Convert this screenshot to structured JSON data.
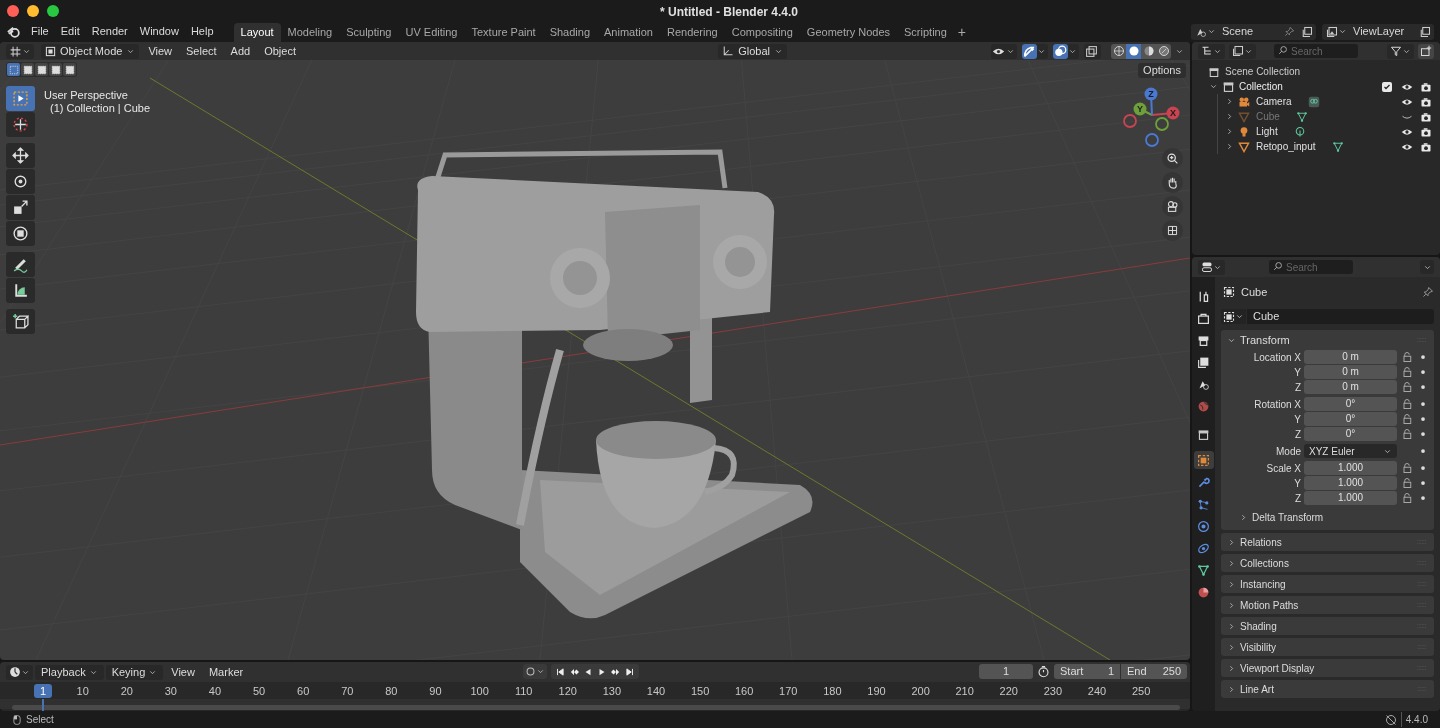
{
  "window": {
    "title": "* Untitled - Blender 4.4.0"
  },
  "menu": [
    "File",
    "Edit",
    "Render",
    "Window",
    "Help"
  ],
  "workspaces": [
    {
      "label": "Layout",
      "selected": true
    },
    {
      "label": "Modeling",
      "selected": false
    },
    {
      "label": "Sculpting",
      "selected": false
    },
    {
      "label": "UV Editing",
      "selected": false
    },
    {
      "label": "Texture Paint",
      "selected": false
    },
    {
      "label": "Shading",
      "selected": false
    },
    {
      "label": "Animation",
      "selected": false
    },
    {
      "label": "Rendering",
      "selected": false
    },
    {
      "label": "Compositing",
      "selected": false
    },
    {
      "label": "Geometry Nodes",
      "selected": false
    },
    {
      "label": "Scripting",
      "selected": false
    }
  ],
  "add_workspace": "+",
  "scene": {
    "scene": "Scene",
    "view_layer": "ViewLayer"
  },
  "viewport": {
    "mode": "Object Mode",
    "menus": [
      "View",
      "Select",
      "Add",
      "Object"
    ],
    "orientation": "Global",
    "options": "Options",
    "info": [
      "User Perspective",
      "(1) Collection | Cube"
    ],
    "select_modes": [
      {
        "selected": true
      },
      {
        "selected": false
      },
      {
        "selected": false
      },
      {
        "selected": false
      },
      {
        "selected": false
      }
    ],
    "toggles": [
      {
        "kind": "visibility",
        "on": false
      },
      {
        "kind": "gizmo",
        "on": true
      },
      {
        "kind": "overlay",
        "on": true
      },
      {
        "kind": "xray",
        "on": false
      }
    ],
    "shading": [
      {
        "kind": "wireframe",
        "selected": false
      },
      {
        "kind": "solid",
        "selected": true
      },
      {
        "kind": "material",
        "selected": false
      },
      {
        "kind": "rendered",
        "selected": false
      }
    ],
    "axes": [
      "X",
      "Y",
      "Z"
    ],
    "tools": [
      [
        {
          "kind": "select",
          "selected": true
        },
        {
          "kind": "cursor",
          "selected": false
        }
      ],
      [
        {
          "kind": "move",
          "selected": false
        },
        {
          "kind": "rotate",
          "selected": false
        },
        {
          "kind": "scale",
          "selected": false
        },
        {
          "kind": "transform",
          "selected": false
        }
      ],
      [
        {
          "kind": "annotate",
          "selected": false
        },
        {
          "kind": "measure",
          "selected": false
        }
      ],
      [
        {
          "kind": "add_cube",
          "selected": false
        }
      ]
    ]
  },
  "outliner": {
    "search_placeholder": "Search",
    "root": "Scene Collection",
    "collection": {
      "label": "Collection",
      "expanded": true,
      "checked": true,
      "children": [
        {
          "label": "Camera",
          "kind": "camera",
          "hidden": false
        },
        {
          "label": "Cube",
          "kind": "mesh",
          "hidden": true
        },
        {
          "label": "Light",
          "kind": "light",
          "hidden": false
        },
        {
          "label": "Retopo_input",
          "kind": "mesh",
          "hidden": false
        }
      ]
    }
  },
  "properties": {
    "search_placeholder": "Search",
    "object": "Cube",
    "name": "Cube",
    "tabs": [
      {
        "kind": "tool",
        "selected": false
      },
      {
        "kind": "render",
        "selected": false
      },
      {
        "kind": "output",
        "selected": false
      },
      {
        "kind": "view_layer",
        "selected": false
      },
      {
        "kind": "scene",
        "selected": false
      },
      {
        "kind": "world",
        "selected": false
      },
      {
        "kind": "collection",
        "selected": false
      },
      {
        "kind": "object",
        "selected": true
      },
      {
        "kind": "modifiers",
        "selected": false
      },
      {
        "kind": "particles",
        "selected": false
      },
      {
        "kind": "physics",
        "selected": false
      },
      {
        "kind": "constraints",
        "selected": false
      },
      {
        "kind": "data",
        "selected": false
      },
      {
        "kind": "material",
        "selected": false
      }
    ],
    "transform": {
      "label": "Transform",
      "expanded": true,
      "groups": [
        [
          {
            "label": "Location X",
            "value": "0 m",
            "kind": "number"
          },
          {
            "label": "Y",
            "value": "0 m",
            "kind": "number"
          },
          {
            "label": "Z",
            "value": "0 m",
            "kind": "number"
          }
        ],
        [
          {
            "label": "Rotation X",
            "value": "0°",
            "kind": "number"
          },
          {
            "label": "Y",
            "value": "0°",
            "kind": "number"
          },
          {
            "label": "Z",
            "value": "0°",
            "kind": "number"
          }
        ],
        [
          {
            "label": "Mode",
            "value": "XYZ Euler",
            "kind": "dropdown"
          }
        ],
        [
          {
            "label": "Scale X",
            "value": "1.000",
            "kind": "number"
          },
          {
            "label": "Y",
            "value": "1.000",
            "kind": "number"
          },
          {
            "label": "Z",
            "value": "1.000",
            "kind": "number"
          }
        ]
      ],
      "subpanel": "Delta Transform"
    },
    "panels": [
      "Relations",
      "Collections",
      "Instancing",
      "Motion Paths",
      "Shading",
      "Visibility",
      "Viewport Display",
      "Line Art"
    ]
  },
  "timeline": {
    "menus": [
      "Playback",
      "Keying",
      "View",
      "Marker"
    ],
    "current_frame": "1",
    "start_label": "Start",
    "start": "1",
    "end_label": "End",
    "end": "250",
    "ruler": [
      "1",
      "10",
      "20",
      "30",
      "40",
      "50",
      "60",
      "70",
      "80",
      "90",
      "100",
      "110",
      "120",
      "130",
      "140",
      "150",
      "160",
      "170",
      "180",
      "190",
      "200",
      "210",
      "220",
      "230",
      "240",
      "250"
    ]
  },
  "status": {
    "hint": "Select",
    "version": "4.4.0"
  }
}
